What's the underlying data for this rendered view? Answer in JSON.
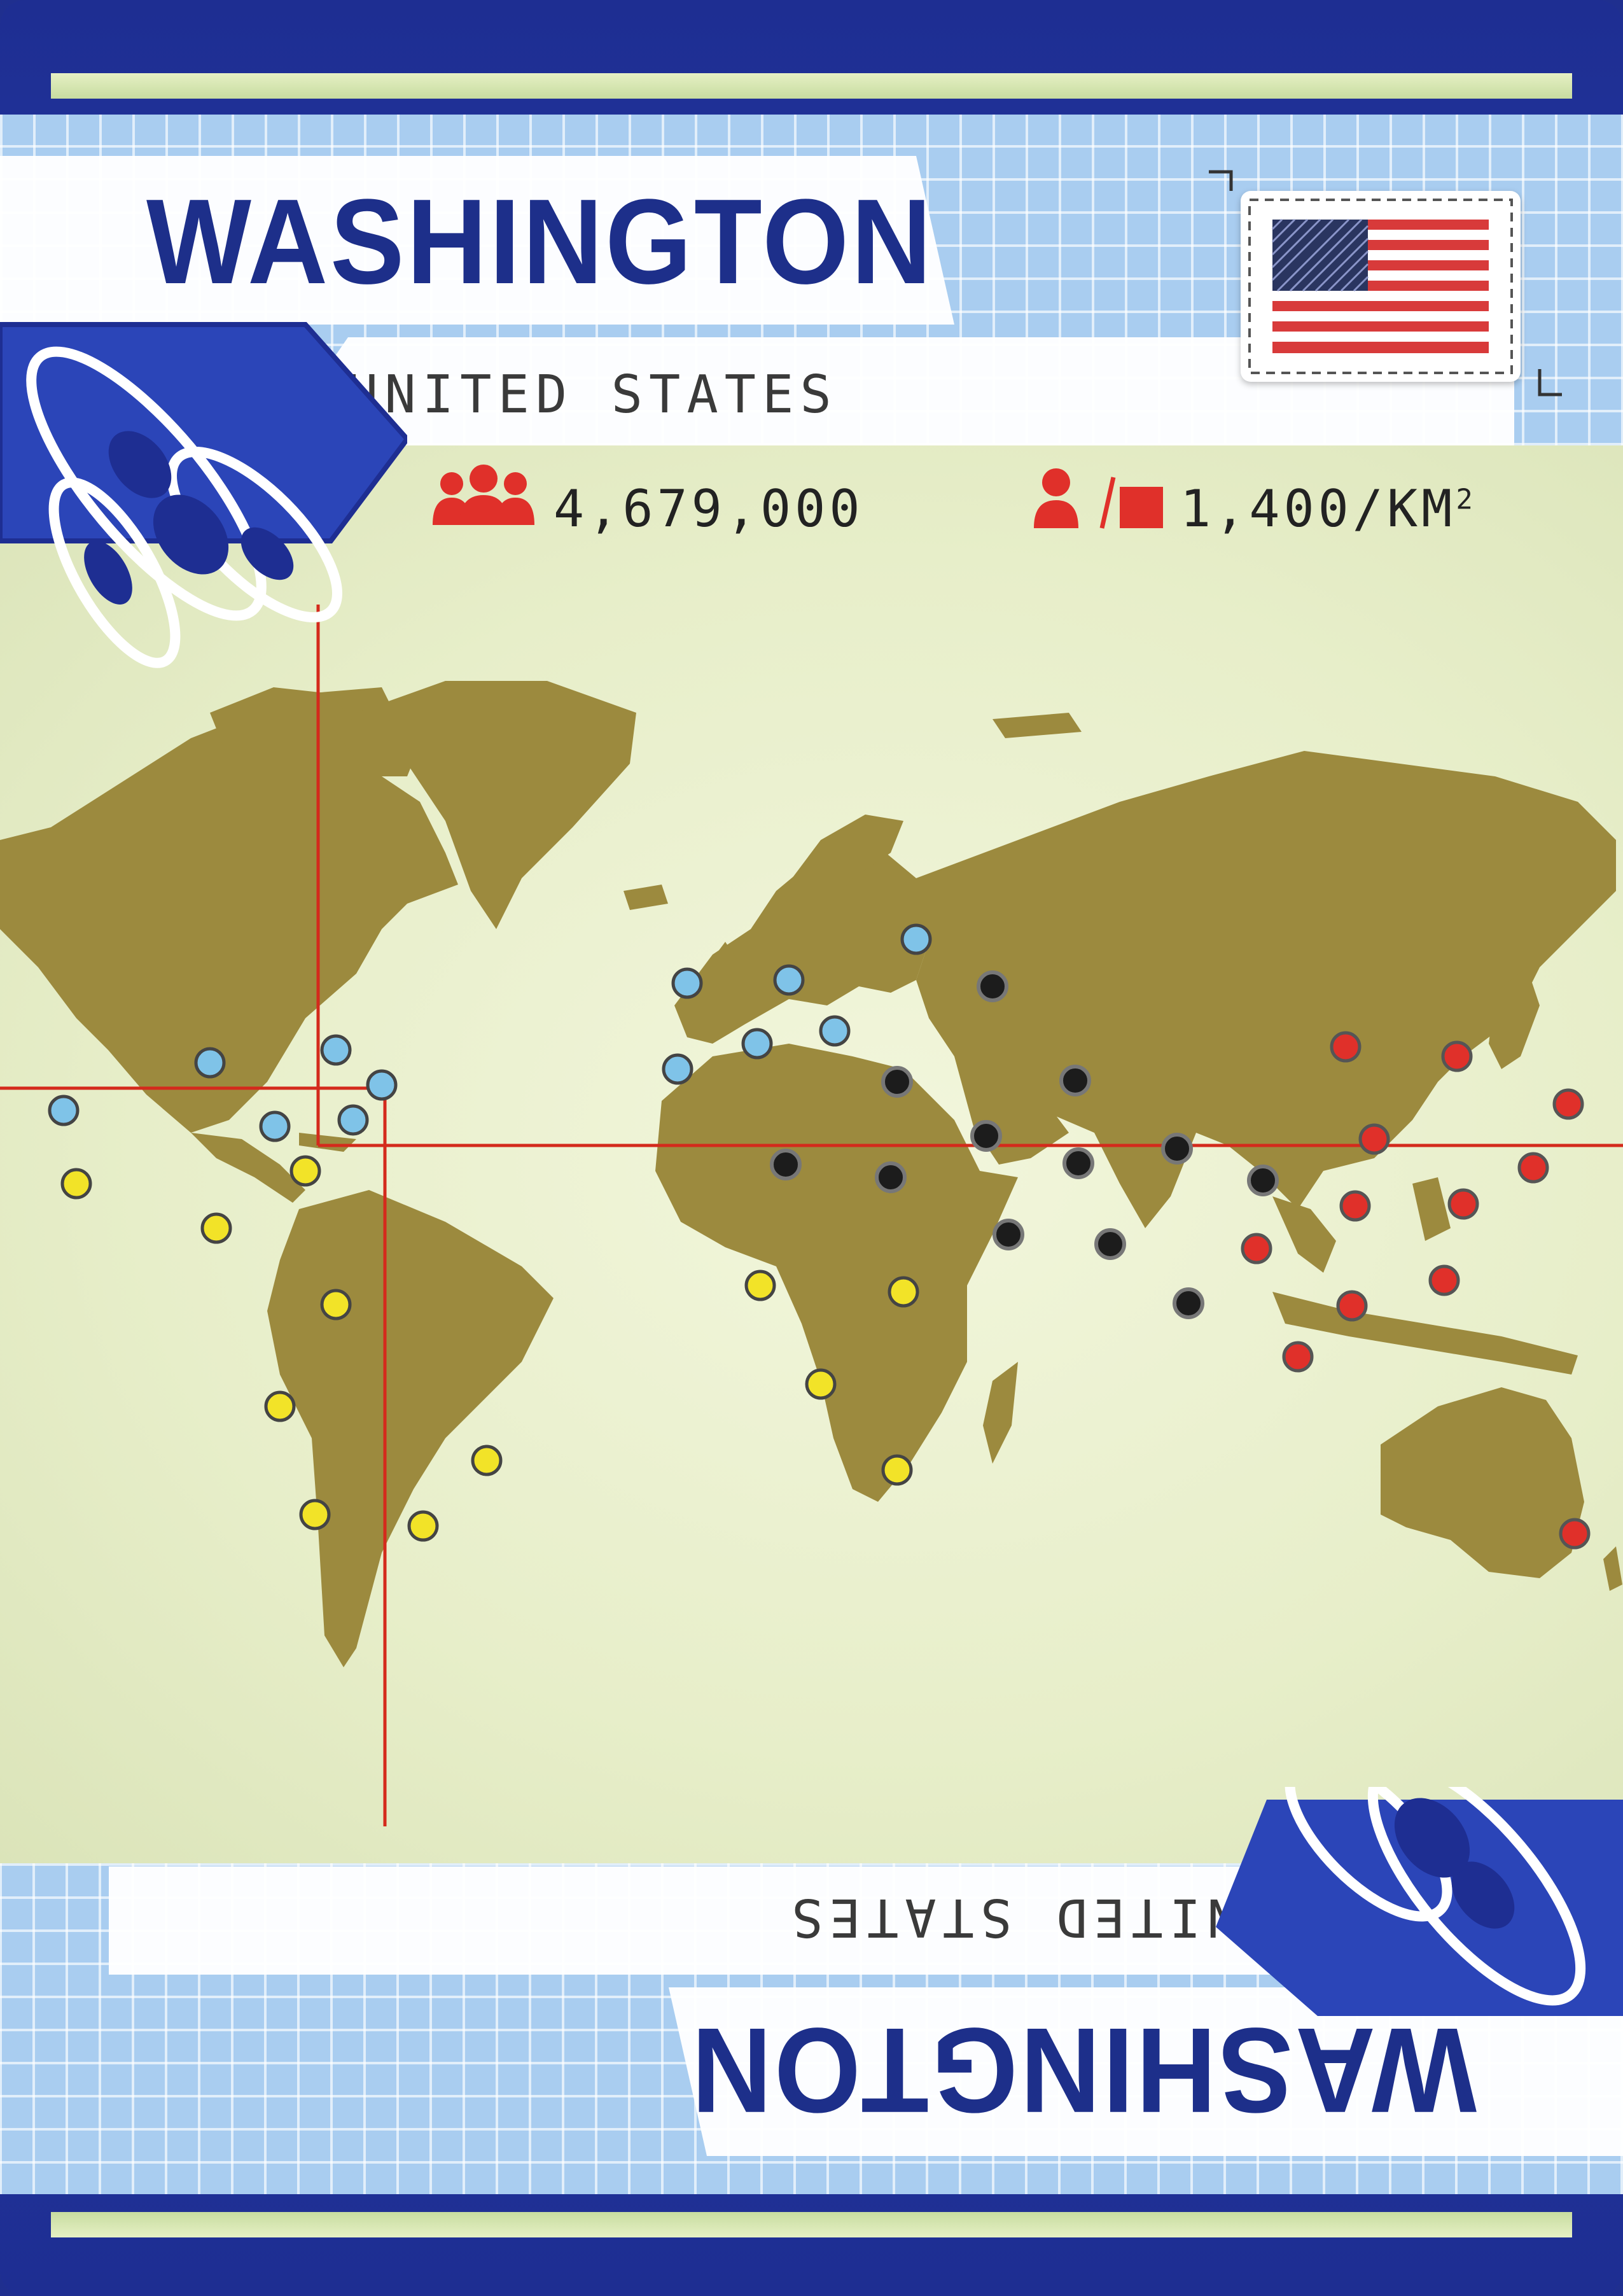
{
  "card": {
    "city": "WASHINGTON",
    "country": "UNITED STATES",
    "population": "4,679,000",
    "density": "1,400/KM",
    "density_sup": "2"
  },
  "colors": {
    "card_blue": "#1e2e92",
    "title_blue": "#1d2f8a",
    "land": "#9c8a3e",
    "background": "#eaf0cf",
    "route_red": "#d42a1c",
    "city_blue": "#7fc3e8",
    "city_yellow": "#f2e328",
    "city_black": "#1c1c1c",
    "city_red": "#e0302a"
  },
  "icons": [
    "population-icon",
    "density-icon",
    "flag-icon",
    "disease-logo-icon"
  ]
}
